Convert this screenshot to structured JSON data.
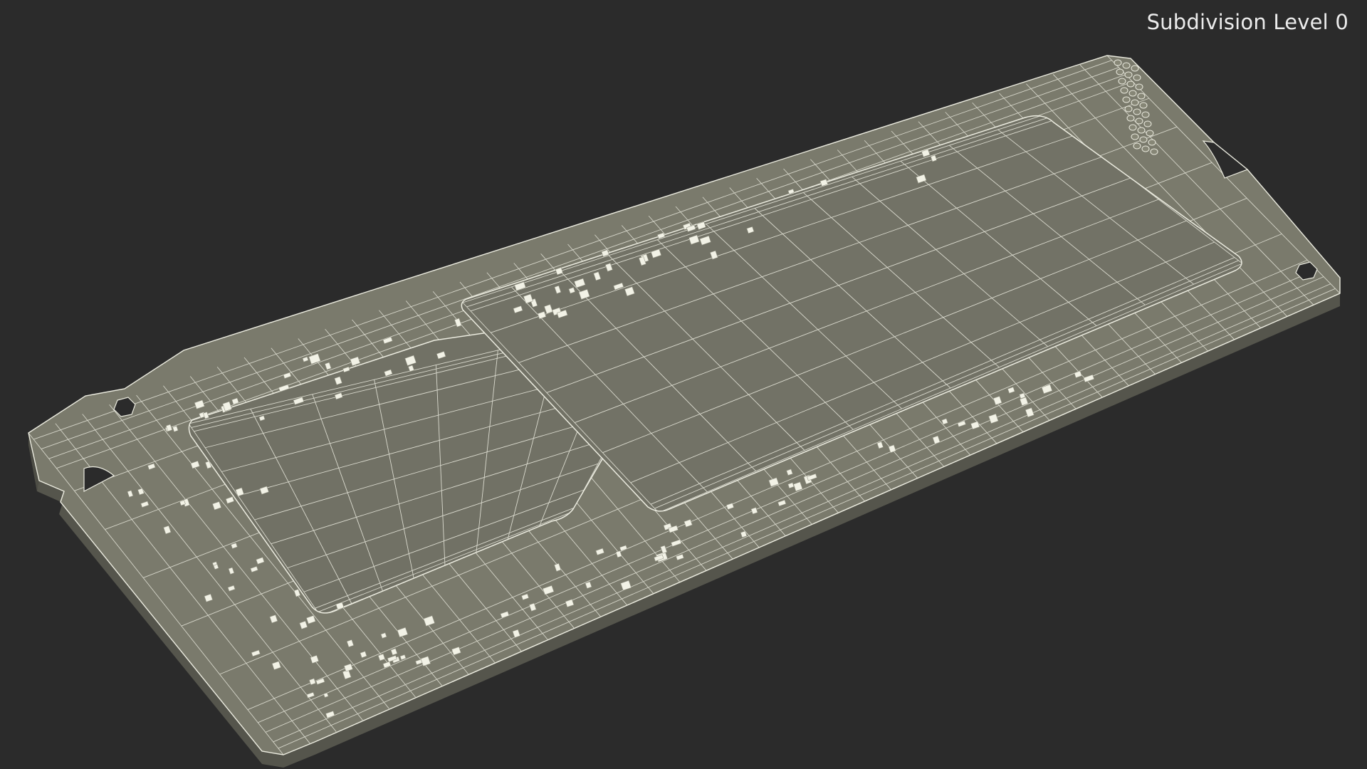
{
  "overlay": {
    "subdivision_label": "Subdivision Level 0"
  },
  "scene": {
    "object": "ssd-circuit-board-icon",
    "render_mode": "wireframe-on-shaded",
    "colors": {
      "background": "#2b2b2b",
      "board_side": "#5e5e55",
      "board_top": "#7a7a6c",
      "chip_top": "#727266",
      "wire": "#e9e9dd",
      "component": "#f2f2e6"
    }
  }
}
